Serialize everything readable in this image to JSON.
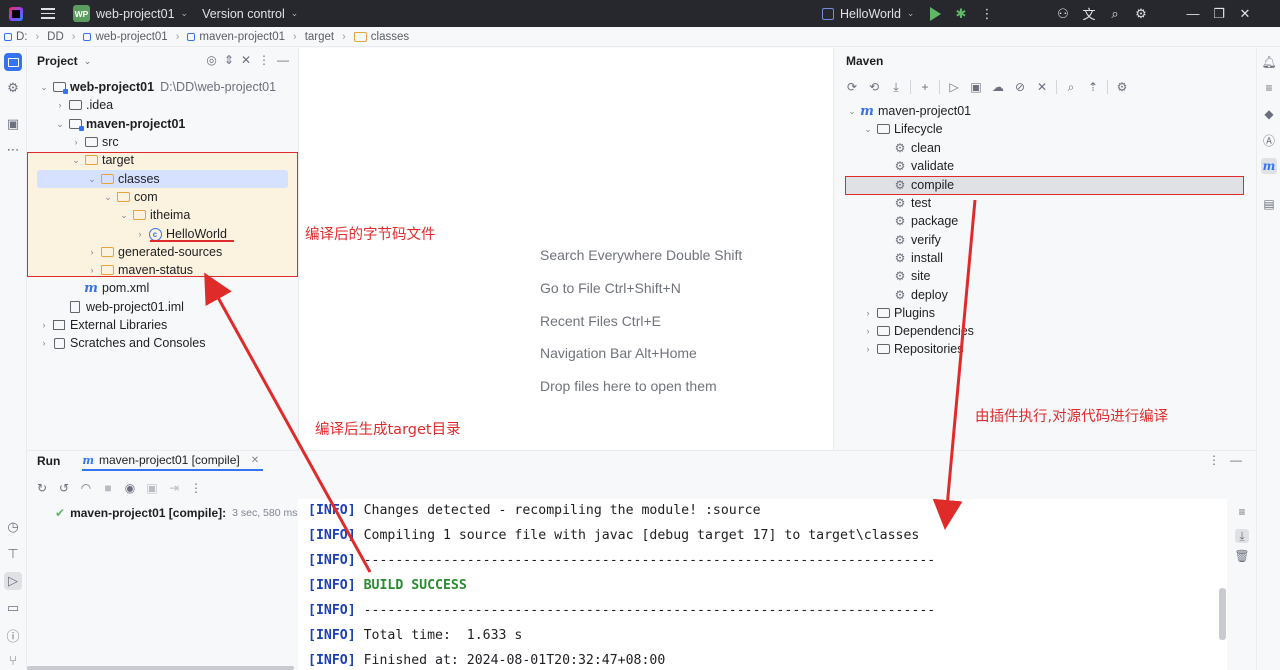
{
  "titlebar": {
    "project_badge": "WP",
    "project_name": "web-project01",
    "version_control": "Version control",
    "run_config": "HelloWorld"
  },
  "breadcrumb": [
    "D:",
    "DD",
    "web-project01",
    "maven-project01",
    "target",
    "classes"
  ],
  "project_panel": {
    "title": "Project",
    "tree": [
      {
        "label": "web-project01",
        "path": "D:\\DD\\web-project01"
      },
      {
        "label": ".idea"
      },
      {
        "label": "maven-project01"
      },
      {
        "label": "src"
      },
      {
        "label": "target"
      },
      {
        "label": "classes"
      },
      {
        "label": "com"
      },
      {
        "label": "itheima"
      },
      {
        "label": "HelloWorld"
      },
      {
        "label": "generated-sources"
      },
      {
        "label": "maven-status"
      },
      {
        "label": "pom.xml"
      },
      {
        "label": "web-project01.iml"
      },
      {
        "label": "External Libraries"
      },
      {
        "label": "Scratches and Consoles"
      }
    ]
  },
  "editor_hints": [
    "Search Everywhere Double Shift",
    "Go to File Ctrl+Shift+N",
    "Recent Files Ctrl+E",
    "Navigation Bar Alt+Home",
    "Drop files here to open them"
  ],
  "maven_panel": {
    "title": "Maven",
    "project": "maven-project01",
    "lifecycle_label": "Lifecycle",
    "lifecycle": [
      "clean",
      "validate",
      "compile",
      "test",
      "package",
      "verify",
      "install",
      "site",
      "deploy"
    ],
    "plugins": "Plugins",
    "dependencies": "Dependencies",
    "repositories": "Repositories"
  },
  "run_panel": {
    "title": "Run",
    "tab_label": "maven-project01 [compile]",
    "tree_item": "maven-project01 [compile]:",
    "tree_timing": "3 sec, 580 ms",
    "console": [
      {
        "tag": "[INFO]",
        "text": " Changes detected - recompiling the module! :source",
        "success": false
      },
      {
        "tag": "[INFO]",
        "text": " Compiling 1 source file with javac [debug target 17] to target\\classes",
        "success": false
      },
      {
        "tag": "[INFO]",
        "text": " ------------------------------------------------------------------------",
        "success": false
      },
      {
        "tag": "[INFO]",
        "text": " BUILD SUCCESS",
        "success": true
      },
      {
        "tag": "[INFO]",
        "text": " ------------------------------------------------------------------------",
        "success": false
      },
      {
        "tag": "[INFO]",
        "text": " Total time:  1.633 s",
        "success": false
      },
      {
        "tag": "[INFO]",
        "text": " Finished at: 2024-08-01T20:32:47+08:00",
        "success": false
      }
    ]
  },
  "annotations": {
    "bytecode": "编译后的字节码文件",
    "target_dir": "编译后生成target目录",
    "plugin_exec": "由插件执行,对源代码进行编译"
  },
  "colors": {
    "annotation_red": "#e02b2b",
    "accent_blue": "#3574f0",
    "success_green": "#2a8a31"
  }
}
